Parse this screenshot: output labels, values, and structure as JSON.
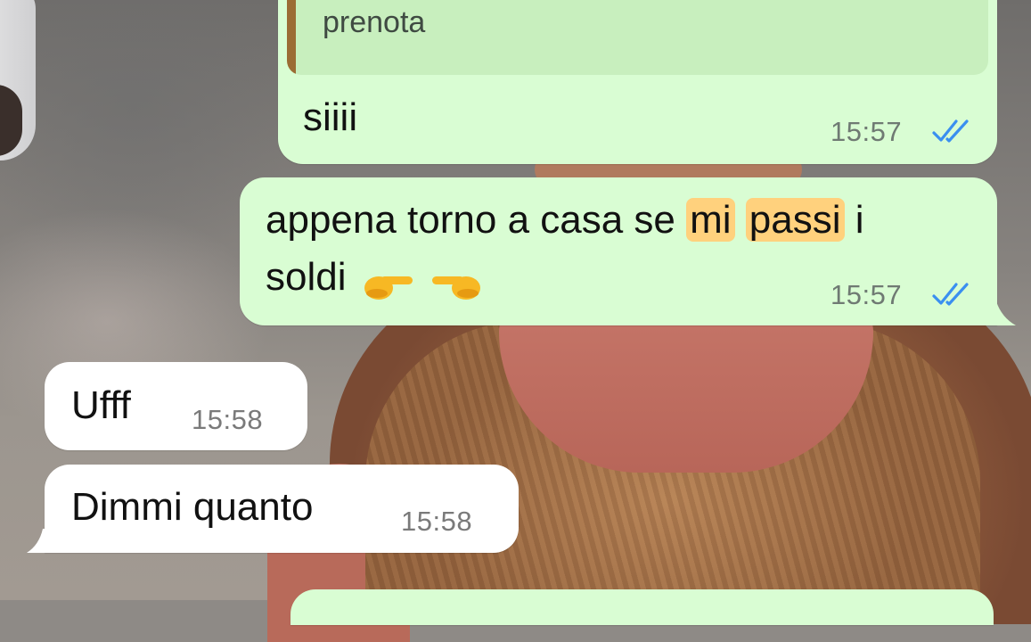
{
  "chat": {
    "messages": [
      {
        "direction": "outgoing",
        "quoted_text": "prenota",
        "text": "siiii",
        "time": "15:57",
        "status": "read"
      },
      {
        "direction": "outgoing",
        "text_parts": [
          "appena torno a casa se ",
          "mi",
          " ",
          "passi",
          " i",
          "soldi"
        ],
        "emojis": [
          "backhand-index-pointing-right-emoji",
          "backhand-index-pointing-left-emoji"
        ],
        "time": "15:57",
        "status": "read"
      },
      {
        "direction": "incoming",
        "text": "Ufff",
        "time": "15:58"
      },
      {
        "direction": "incoming",
        "text": "Dimmi quanto",
        "time": "15:58"
      }
    ]
  },
  "colors": {
    "outgoing_bubble": "#d9fdd3",
    "incoming_bubble": "#ffffff",
    "read_ticks": "#3a8ff0",
    "highlight": "#ffd17d",
    "quote_bar": "#9b6c34"
  }
}
